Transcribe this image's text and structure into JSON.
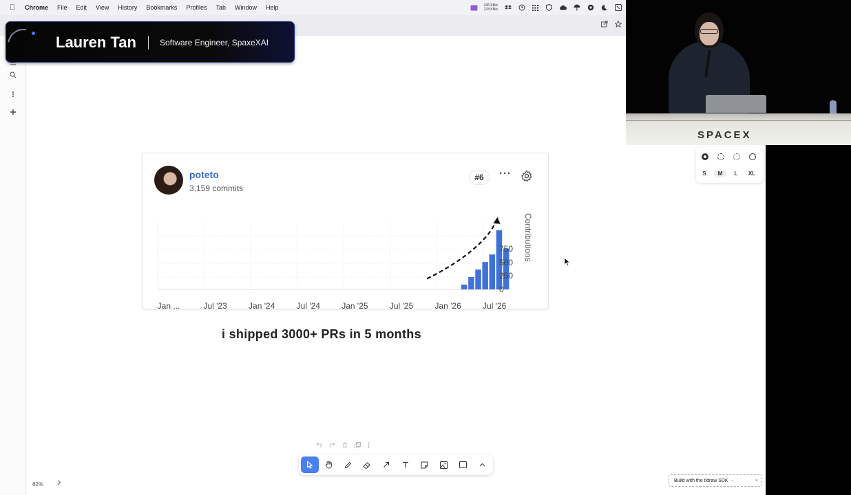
{
  "menubar": {
    "items": [
      "Chrome",
      "File",
      "Edit",
      "View",
      "History",
      "Bookmarks",
      "Profiles",
      "Tab",
      "Window",
      "Help"
    ],
    "net_up": "436 KB/s",
    "net_down": "278 KB/s"
  },
  "banner": {
    "name": "Lauren Tan",
    "role": "Software Engineer, SpaxeXAI"
  },
  "card": {
    "username": "poteto",
    "commits": "3,159 commits",
    "rank": "#6",
    "more": "···"
  },
  "chart_data": {
    "type": "bar",
    "ylabel": "Contributions",
    "x_ticks": [
      "Jan ...",
      "Jul '23",
      "Jan '24",
      "Jul '24",
      "Jan '25",
      "Jul '25",
      "Jan '26",
      "Jul '26"
    ],
    "y_ticks": [
      0,
      250,
      500,
      750
    ],
    "ylim": [
      0,
      1150
    ],
    "bars": [
      {
        "x": 6.35,
        "value": 90
      },
      {
        "x": 6.5,
        "value": 230
      },
      {
        "x": 6.65,
        "value": 370
      },
      {
        "x": 6.8,
        "value": 510
      },
      {
        "x": 6.95,
        "value": 650
      },
      {
        "x": 7.1,
        "value": 1100
      },
      {
        "x": 7.25,
        "value": 760
      }
    ],
    "trend_arrow": [
      [
        5.55,
        200
      ],
      [
        6.4,
        560
      ],
      [
        6.95,
        1000
      ],
      [
        7.05,
        1320
      ]
    ],
    "grid": true,
    "annotation_style": "dashed-arrow"
  },
  "caption": "i shipped 3000+ PRs in 5 months",
  "canvas": {
    "zoom": "82%"
  },
  "video": {
    "stage_logo": "SPACEX"
  },
  "style_panel": {
    "sizes": [
      "S",
      "M",
      "L",
      "XL"
    ],
    "selected_size": "M"
  },
  "sdk_button": "Build with the tldraw SDK →",
  "icons": {
    "apple": "apple-icon",
    "select": "cursor-arrow-icon",
    "hand": "hand-icon",
    "draw": "pencil-icon",
    "eraser": "eraser-icon",
    "arrow": "arrow-icon",
    "text": "text-icon",
    "note": "sticky-note-icon",
    "image": "image-icon",
    "rectangle": "rectangle-icon",
    "more": "chevron-up-icon"
  },
  "colors": {
    "bar": "#3f72d8",
    "toolbar_active": "#4a7ff1",
    "username": "#3a6ad0"
  }
}
